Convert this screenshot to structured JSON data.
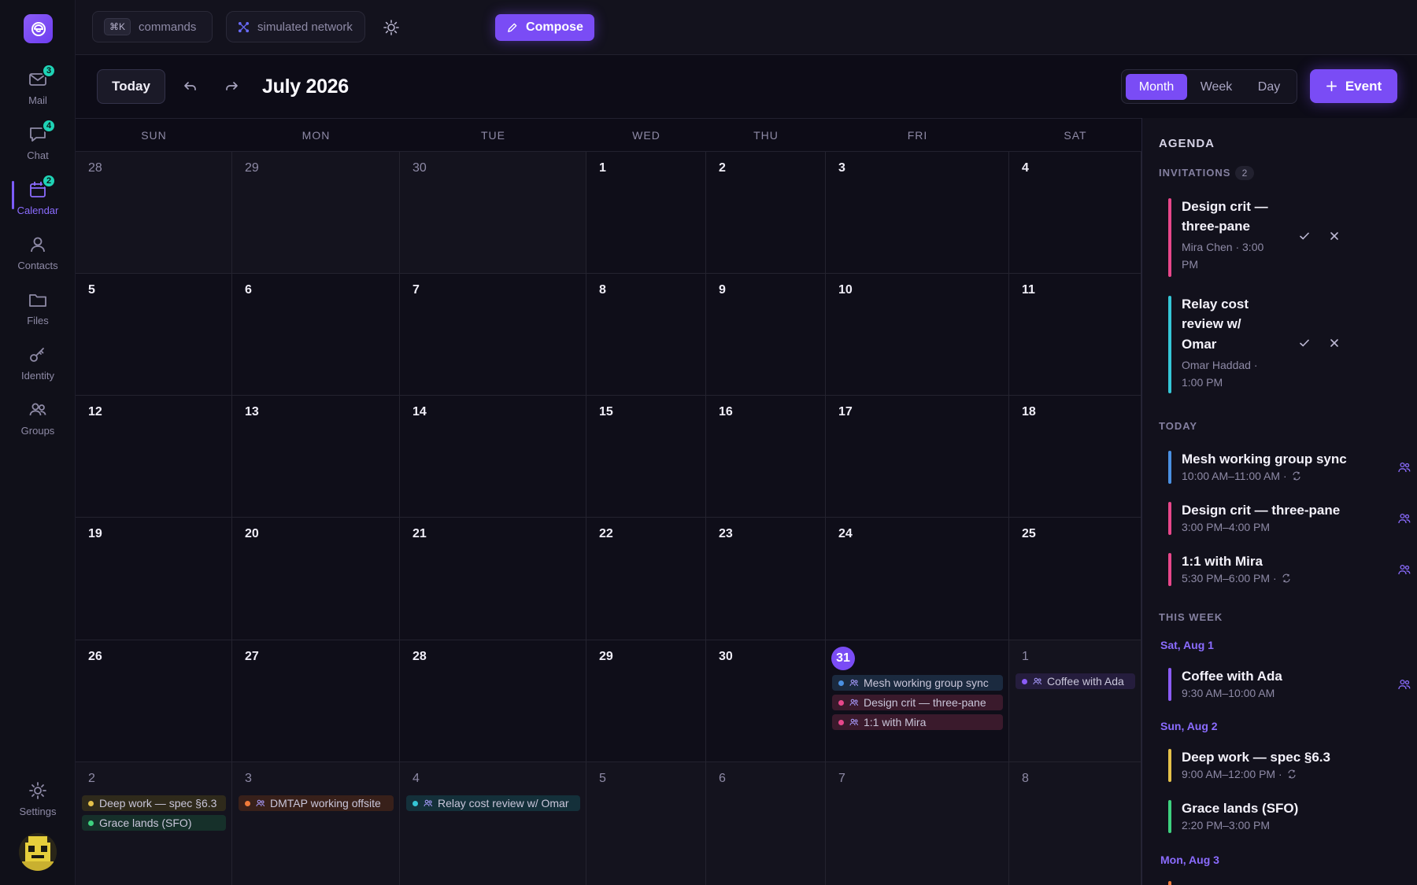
{
  "rail": {
    "items": [
      {
        "label": "Mail",
        "badge": "3"
      },
      {
        "label": "Chat",
        "badge": "4"
      },
      {
        "label": "Calendar",
        "badge": "2"
      },
      {
        "label": "Contacts"
      },
      {
        "label": "Files"
      },
      {
        "label": "Identity"
      },
      {
        "label": "Groups"
      }
    ],
    "settings_label": "Settings"
  },
  "topbar": {
    "kbd": "⌘K",
    "commands_label": "commands",
    "network_label": "simulated network",
    "compose_label": "Compose"
  },
  "toolbar": {
    "today_label": "Today",
    "month_title": "July 2026",
    "views": [
      "Month",
      "Week",
      "Day"
    ],
    "active_view": "Month",
    "event_label": "Event"
  },
  "calendar": {
    "weekdays": [
      "SUN",
      "MON",
      "TUE",
      "WED",
      "THU",
      "FRI",
      "SAT"
    ],
    "weeks": [
      [
        "28",
        "29",
        "30",
        "1",
        "2",
        "3",
        "4"
      ],
      [
        "5",
        "6",
        "7",
        "8",
        "9",
        "10",
        "11"
      ],
      [
        "12",
        "13",
        "14",
        "15",
        "16",
        "17",
        "18"
      ],
      [
        "19",
        "20",
        "21",
        "22",
        "23",
        "24",
        "25"
      ],
      [
        "26",
        "27",
        "28",
        "29",
        "30",
        "31",
        "1"
      ],
      [
        "2",
        "3",
        "4",
        "5",
        "6",
        "7",
        "8"
      ]
    ],
    "events": {
      "jul31": [
        {
          "title": "Mesh working group sync",
          "color": "#4a90e2",
          "bg": "#1b2a3f",
          "group": true
        },
        {
          "title": "Design crit — three-pane",
          "color": "#e8478b",
          "bg": "#3a1a2c",
          "group": true
        },
        {
          "title": "1:1 with Mira",
          "color": "#e8478b",
          "bg": "#3a1a2c",
          "group": true
        }
      ],
      "aug1": [
        {
          "title": "Coffee with Ada",
          "color": "#8b5cf6",
          "bg": "#251d3d",
          "group": true
        }
      ],
      "aug2": [
        {
          "title": "Deep work — spec §6.3",
          "color": "#e5c14a",
          "bg": "#2f2a1b",
          "group": false
        },
        {
          "title": "Grace lands (SFO)",
          "color": "#3ed17f",
          "bg": "#16302a",
          "group": false
        }
      ],
      "aug3": [
        {
          "title": "DMTAP working offsite",
          "color": "#ef7a3a",
          "bg": "#38201a",
          "group": true
        }
      ],
      "aug4": [
        {
          "title": "Relay cost review w/ Omar",
          "color": "#35c6d6",
          "bg": "#14303a",
          "group": true
        }
      ]
    }
  },
  "agenda": {
    "title": "AGENDA",
    "invitations_label": "INVITATIONS",
    "invitations_count": "2",
    "invitations": [
      {
        "title_line1": "Design crit —",
        "title_line2": "three-pane",
        "sub_line1": "Mira Chen · 3:00",
        "sub_line2": "PM",
        "color": "#e8478b"
      },
      {
        "title_line1": "Relay cost",
        "title_line2": "review w/",
        "title_line3": "Omar",
        "sub_line1": "Omar Haddad ·",
        "sub_line2": "1:00 PM",
        "color": "#35c6d6"
      }
    ],
    "today_label": "TODAY",
    "today": [
      {
        "title": "Mesh working group sync",
        "time": "10:00 AM–11:00 AM ·",
        "color": "#4a90e2"
      },
      {
        "title": "Design crit — three-pane",
        "time": "3:00 PM–4:00 PM",
        "color": "#e8478b"
      },
      {
        "title": "1:1 with Mira",
        "time": "5:30 PM–6:00 PM ·",
        "color": "#e8478b"
      }
    ],
    "week_label": "THIS WEEK",
    "days": [
      {
        "label": "Sat, Aug 1"
      },
      {
        "label": "Sun, Aug 2"
      },
      {
        "label": "Mon, Aug 3"
      }
    ],
    "week_events": [
      {
        "title": "Coffee with Ada",
        "time": "9:30 AM–10:00 AM",
        "color": "#8b5cf6"
      },
      {
        "title": "Deep work — spec §6.3",
        "time": "9:00 AM–12:00 PM ·",
        "color": "#e5c14a"
      },
      {
        "title": "Grace lands (SFO)",
        "time": "2:20 PM–3:00 PM",
        "color": "#3ed17f"
      },
      {
        "color": "#ef7a3a"
      }
    ]
  }
}
